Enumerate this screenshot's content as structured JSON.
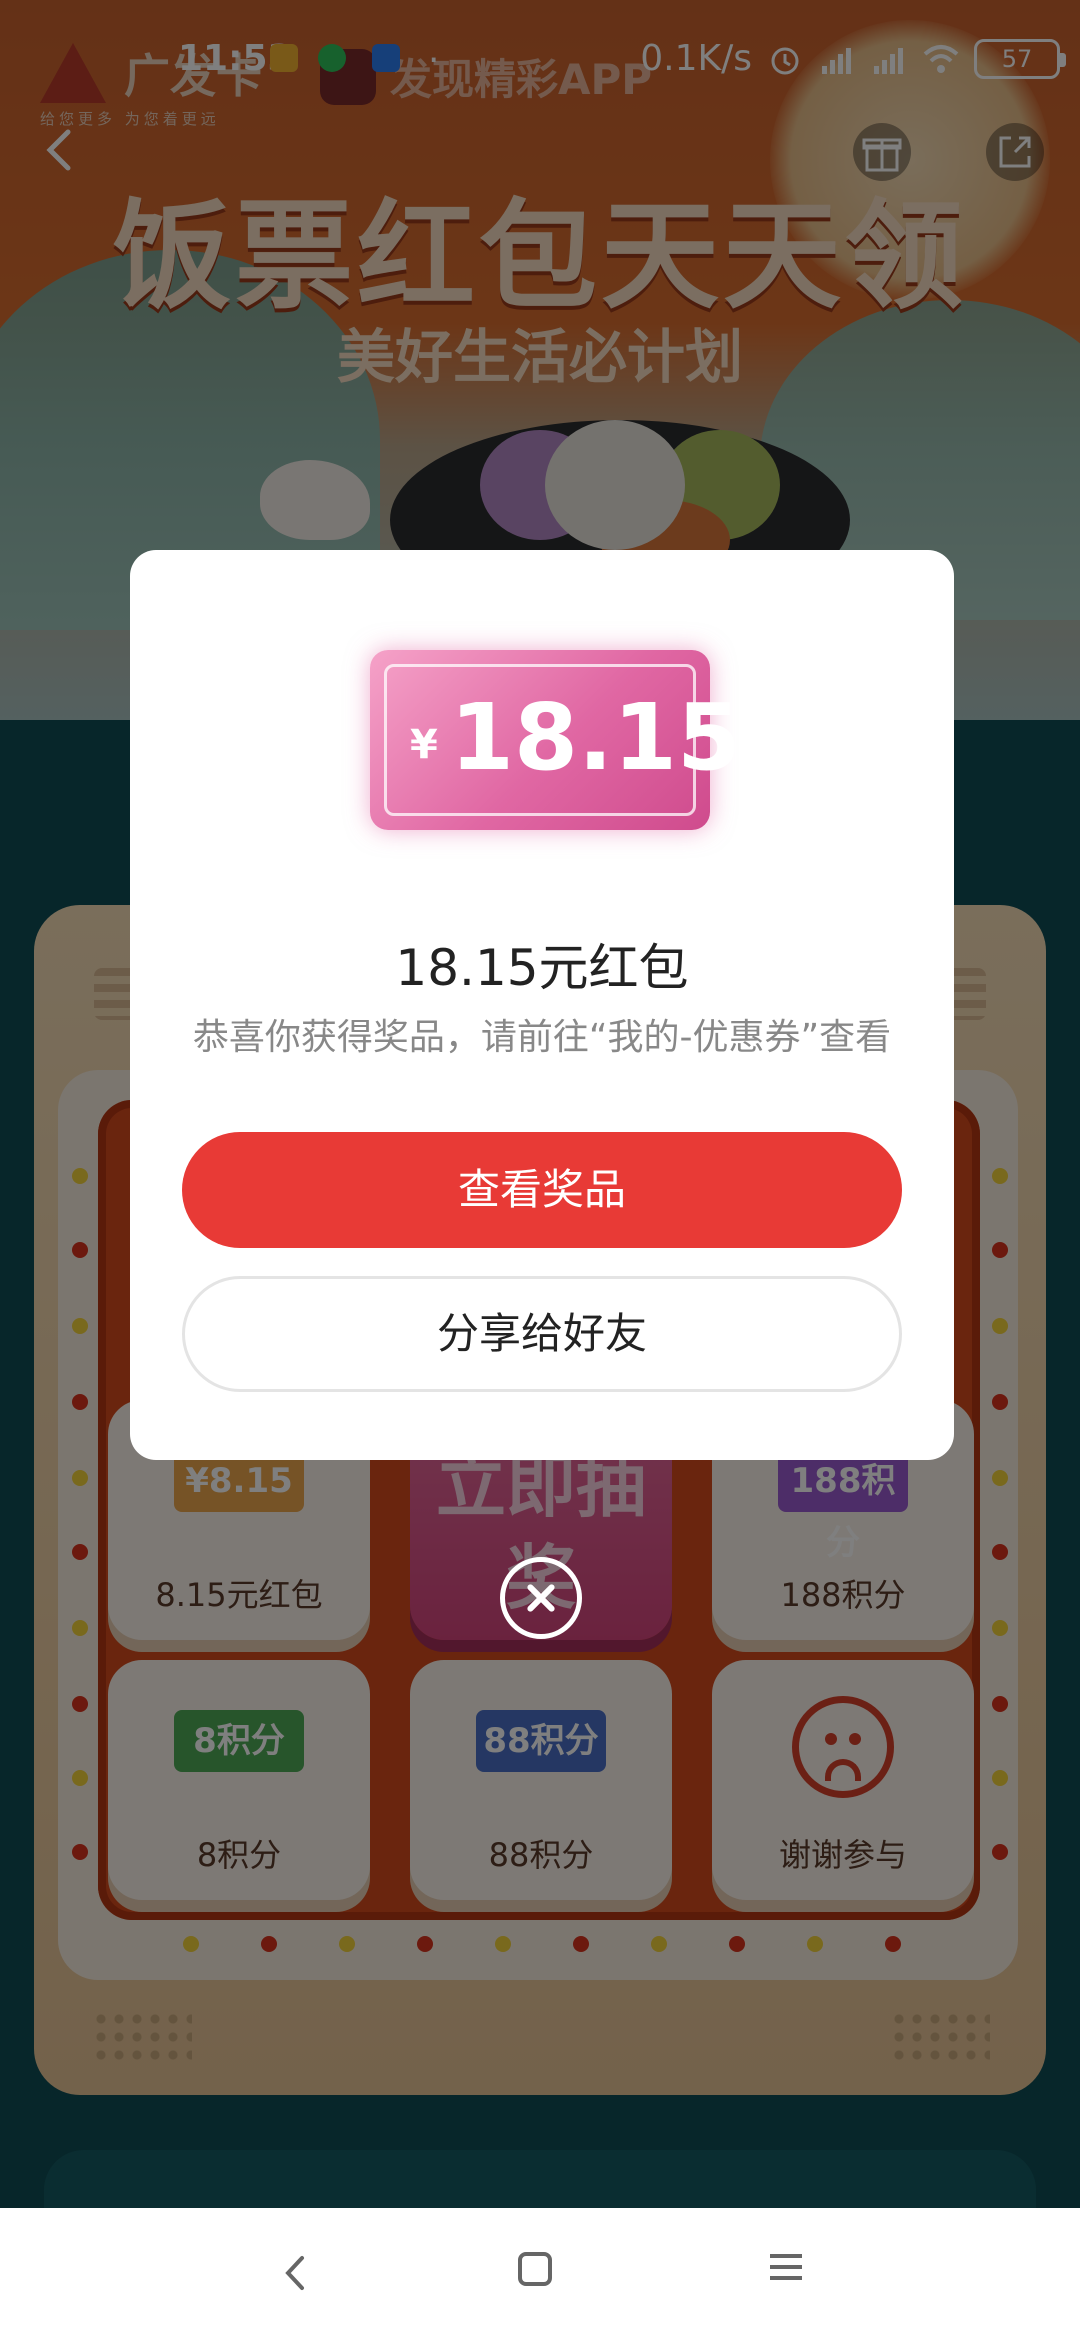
{
  "status_bar": {
    "time": "11:53",
    "dot": "·",
    "net_speed": "0.1K/s",
    "battery": "57",
    "icons": [
      "alarm-icon",
      "hd-signal-icon",
      "hd-signal-icon",
      "wifi-icon"
    ]
  },
  "banner": {
    "brand": "广发卡",
    "tagline": "给您更多 为您着更远",
    "app_name": "发现精彩APP",
    "title": "饭票红包天天领",
    "subtitle": "美好生活必计划"
  },
  "board": {
    "prizes": [
      {
        "ticket": "¥8.15",
        "name": "8.15元红包",
        "color": "#eda64c"
      },
      {
        "draw_label": "立即抽奖"
      },
      {
        "ticket": "188积分",
        "name": "188积分",
        "color": "#9a5bd0"
      },
      {
        "ticket": "8积分",
        "name": "8积分",
        "color": "#4eaa56"
      },
      {
        "ticket": "88积分",
        "name": "88积分",
        "color": "#4a6fc7"
      },
      {
        "name": "谢谢参与",
        "icon": "sad-face-icon"
      }
    ]
  },
  "modal": {
    "coupon_currency": "¥",
    "coupon_amount": "18.15",
    "prize_title": "18.15元红包",
    "message": "恭喜你获得奖品，请前往“我的-优惠券”查看",
    "view_button": "查看奖品",
    "share_button": "分享给好友"
  },
  "colors": {
    "primary_red": "#e83a36",
    "coupon_pink": "#e067a3",
    "board_red": "#d44a1c",
    "background_teal": "#0f4d55"
  }
}
